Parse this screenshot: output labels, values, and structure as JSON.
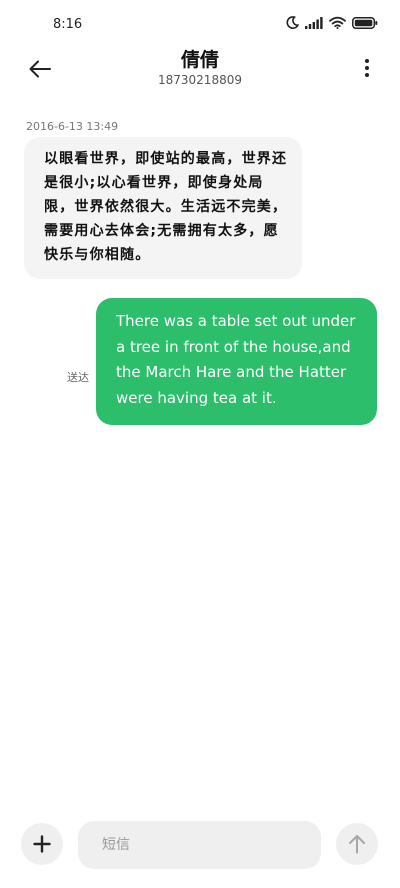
{
  "status_bar": {
    "time": "8:16",
    "icons": [
      "moon-icon",
      "signal-icon",
      "wifi-icon",
      "battery-icon"
    ]
  },
  "header": {
    "back_icon": "back-arrow-icon",
    "contact_name": "倩倩",
    "phone_number": "18730218809",
    "more_icon": "more-vertical-icon"
  },
  "conversation": {
    "timestamp": "2016-6-13  13:49",
    "incoming_message": "以眼看世界，即使站的最高，世界还是很小;以心看世界，即使身处局限，世界依然很大。生活远不完美，需要用心去体会;无需拥有太多，愿快乐与你相随。",
    "outgoing_message": "There was a table set out under a tree in front of the house,and the March Hare and the Hatter were having tea at it.",
    "outgoing_status": "送达"
  },
  "composer": {
    "add_icon": "plus-icon",
    "placeholder": "短信",
    "value": "",
    "send_icon": "arrow-up-icon"
  },
  "colors": {
    "outgoing_bubble": "#2dbe6c",
    "incoming_bubble": "#f4f4f4",
    "button_bg": "#efefef"
  }
}
